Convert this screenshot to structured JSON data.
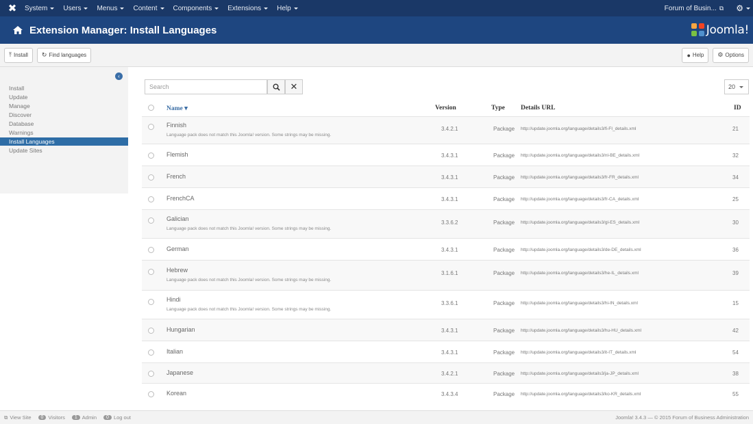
{
  "navbar": {
    "logo_icon": "joomla-x-icon",
    "menu": [
      {
        "label": "System"
      },
      {
        "label": "Users"
      },
      {
        "label": "Menus"
      },
      {
        "label": "Content"
      },
      {
        "label": "Components"
      },
      {
        "label": "Extensions"
      },
      {
        "label": "Help"
      }
    ],
    "site_label": "Forum of Busin...",
    "gear_icon": "gear-icon"
  },
  "header": {
    "title": "Extension Manager: Install Languages",
    "brand": "Joomla!"
  },
  "toolbar": {
    "install_label": "Install",
    "find_languages_label": "Find languages",
    "help_label": "Help",
    "options_label": "Options"
  },
  "sidebar": {
    "items": [
      {
        "label": "Install",
        "active": false
      },
      {
        "label": "Update",
        "active": false
      },
      {
        "label": "Manage",
        "active": false
      },
      {
        "label": "Discover",
        "active": false
      },
      {
        "label": "Database",
        "active": false
      },
      {
        "label": "Warnings",
        "active": false
      },
      {
        "label": "Install Languages",
        "active": true
      },
      {
        "label": "Update Sites",
        "active": false
      }
    ]
  },
  "filter": {
    "search_placeholder": "Search",
    "limit_value": "20"
  },
  "table": {
    "headers": {
      "name": "Name",
      "version": "Version",
      "type": "Type",
      "details_url": "Details URL",
      "id": "ID"
    },
    "rows": [
      {
        "name": "Finnish",
        "note": "Language pack does not match this Joomla! version. Some strings may be missing.",
        "version": "3.4.2.1",
        "type": "Package",
        "url": "http://update.joomla.org/language/details3/fi-FI_details.xml",
        "id": "21"
      },
      {
        "name": "Flemish",
        "note": "",
        "version": "3.4.3.1",
        "type": "Package",
        "url": "http://update.joomla.org/language/details3/nl-BE_details.xml",
        "id": "32"
      },
      {
        "name": "French",
        "note": "",
        "version": "3.4.3.1",
        "type": "Package",
        "url": "http://update.joomla.org/language/details3/fr-FR_details.xml",
        "id": "34"
      },
      {
        "name": "FrenchCA",
        "note": "",
        "version": "3.4.3.1",
        "type": "Package",
        "url": "http://update.joomla.org/language/details3/fr-CA_details.xml",
        "id": "25"
      },
      {
        "name": "Galician",
        "note": "Language pack does not match this Joomla! version. Some strings may be missing.",
        "version": "3.3.6.2",
        "type": "Package",
        "url": "http://update.joomla.org/language/details3/gl-ES_details.xml",
        "id": "30"
      },
      {
        "name": "German",
        "note": "",
        "version": "3.4.3.1",
        "type": "Package",
        "url": "http://update.joomla.org/language/details3/de-DE_details.xml",
        "id": "36"
      },
      {
        "name": "Hebrew",
        "note": "Language pack does not match this Joomla! version. Some strings may be missing.",
        "version": "3.1.6.1",
        "type": "Package",
        "url": "http://update.joomla.org/language/details3/he-IL_details.xml",
        "id": "39"
      },
      {
        "name": "Hindi",
        "note": "Language pack does not match this Joomla! version. Some strings may be missing.",
        "version": "3.3.6.1",
        "type": "Package",
        "url": "http://update.joomla.org/language/details3/hi-IN_details.xml",
        "id": "15"
      },
      {
        "name": "Hungarian",
        "note": "",
        "version": "3.4.3.1",
        "type": "Package",
        "url": "http://update.joomla.org/language/details3/hu-HU_details.xml",
        "id": "42"
      },
      {
        "name": "Italian",
        "note": "",
        "version": "3.4.3.1",
        "type": "Package",
        "url": "http://update.joomla.org/language/details3/it-IT_details.xml",
        "id": "54"
      },
      {
        "name": "Japanese",
        "note": "",
        "version": "3.4.2.1",
        "type": "Package",
        "url": "http://update.joomla.org/language/details3/ja-JP_details.xml",
        "id": "38"
      },
      {
        "name": "Korean",
        "note": "",
        "version": "3.4.3.4",
        "type": "Package",
        "url": "http://update.joomla.org/language/details3/ko-KR_details.xml",
        "id": "55"
      }
    ]
  },
  "statusbar": {
    "left": [
      {
        "badge": "",
        "label": "View Site"
      },
      {
        "badge": "0",
        "label": "Visitors"
      },
      {
        "badge": "1",
        "label": "Admin"
      },
      {
        "badge": "0",
        "label": "Log out"
      }
    ],
    "right": "Joomla! 3.4.3 — © 2015 Forum of Business Administration"
  },
  "colors": {
    "navbar_bg": "#1a3867",
    "header_bg": "#1e4680",
    "active_sidebar": "#2e6da6"
  }
}
